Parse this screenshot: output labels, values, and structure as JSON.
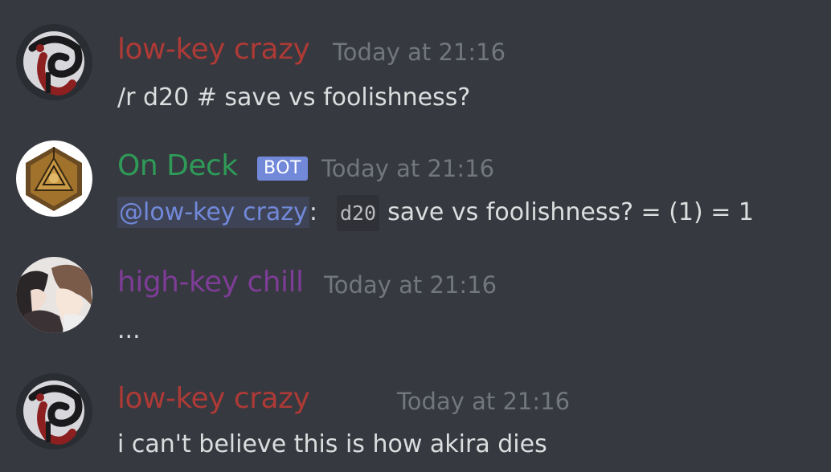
{
  "colors": {
    "background": "#36393f",
    "low_key_crazy": "#ad3a36",
    "on_deck": "#2f9a58",
    "high_key_chill": "#7d3d96",
    "timestamp": "#72767d",
    "text": "#dcddde",
    "mention": "#7289da",
    "bot_tag": "#7289da"
  },
  "messages": [
    {
      "author": "low-key crazy",
      "avatar_icon": "spiral-demon-avatar",
      "timestamp": "Today at 21:16",
      "content": "/r d20 # save vs foolishness?"
    },
    {
      "author": "On Deck",
      "avatar_icon": "d20-dice-avatar",
      "bot_tag": "BOT",
      "timestamp": "Today at 21:16",
      "mention": "@low-key crazy",
      "separator": ":",
      "code": "d20",
      "content": "save vs foolishness? = (1) = 1"
    },
    {
      "author": "high-key chill",
      "avatar_icon": "anime-characters-avatar",
      "timestamp": "Today at 21:16",
      "content": "..."
    },
    {
      "author": "low-key crazy",
      "avatar_icon": "spiral-demon-avatar",
      "timestamp": "Today at 21:16",
      "content": "i can't believe this is how akira dies"
    }
  ]
}
